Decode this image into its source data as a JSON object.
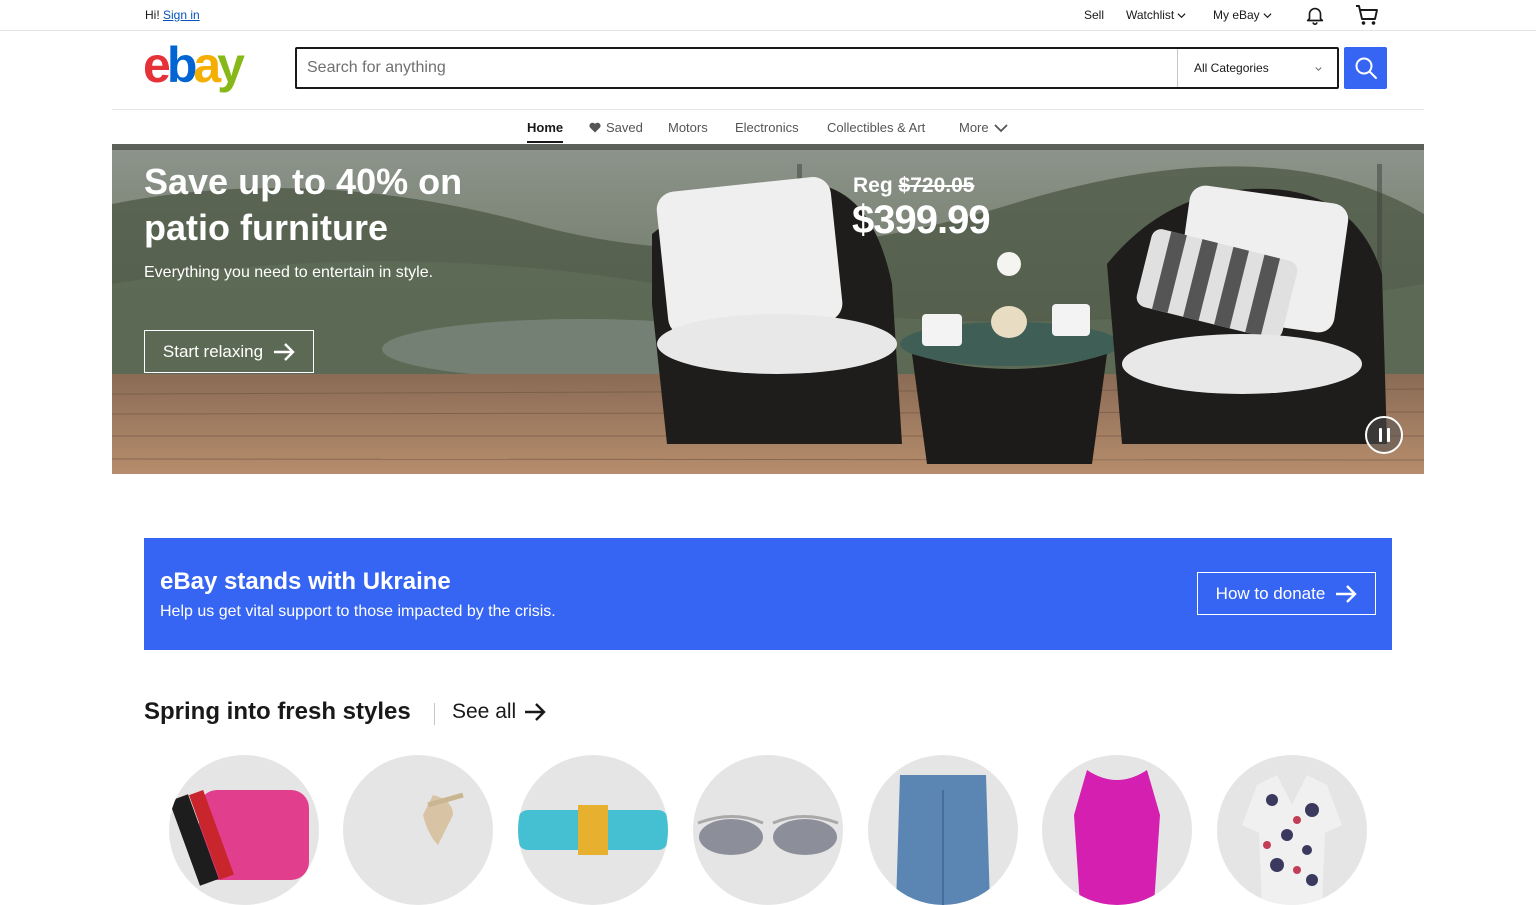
{
  "topbar": {
    "greeting": "Hi!",
    "signin": "Sign in",
    "sell": "Sell",
    "watchlist": "Watchlist",
    "myebay": "My eBay"
  },
  "search": {
    "placeholder": "Search for anything",
    "category": "All Categories"
  },
  "nav": {
    "home": "Home",
    "saved": "Saved",
    "motors": "Motors",
    "electronics": "Electronics",
    "collectibles": "Collectibles & Art",
    "more": "More"
  },
  "hero": {
    "title": "Save up to 40% on patio furniture",
    "subtitle": "Everything you need to entertain in style.",
    "button": "Start relaxing",
    "reg_label": "Reg",
    "reg_price": "$720.05",
    "sale_price": "$399.99"
  },
  "ukraine": {
    "title": "eBay stands with Ukraine",
    "subtitle": "Help us get vital support to those impacted by the crisis.",
    "button": "How to donate"
  },
  "spring": {
    "title": "Spring into fresh styles",
    "see_all": "See all",
    "items": [
      "handbag",
      "sandal",
      "bracelet",
      "sunglasses",
      "jeans",
      "dress",
      "top"
    ]
  },
  "colors": {
    "accent": "#3665f3",
    "logo_e": "#e53238",
    "logo_b": "#0064d2",
    "logo_a": "#f5af02",
    "logo_y": "#86b817"
  }
}
